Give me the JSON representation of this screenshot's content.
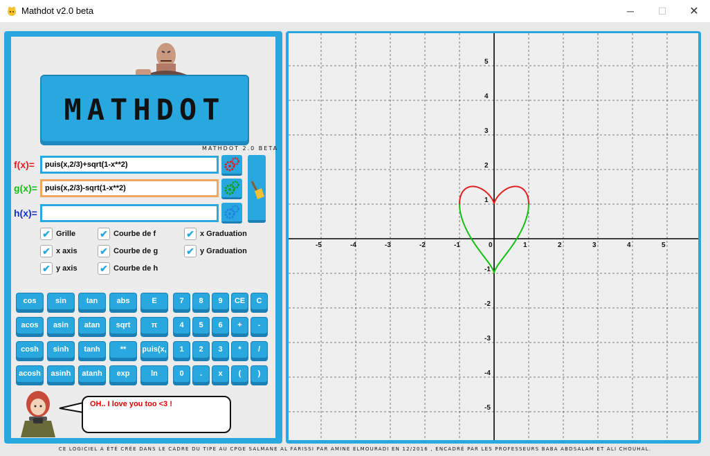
{
  "window": {
    "title": "Mathdot v2.0 beta",
    "minimize_glyph": "─",
    "maximize_glyph": "☐",
    "close_glyph": "✕"
  },
  "logo": {
    "text": "MATHDOT",
    "version": "MATHDOT 2.0 BETA"
  },
  "functions": [
    {
      "label": "f(x)=",
      "value": "puis(x,2/3)+sqrt(1-x**2)",
      "color": "#e02020",
      "icon": "red-gears-icon",
      "gear_color": "#e02020"
    },
    {
      "label": "g(x)=",
      "value": "puis(x,2/3)-sqrt(1-x**2)",
      "color": "#10c010",
      "icon": "green-gears-icon",
      "gear_color": "#10a010"
    },
    {
      "label": "h(x)=",
      "value": "",
      "color": "#1030d0",
      "icon": "blue-gears-icon",
      "gear_color": "#2080e0"
    }
  ],
  "options": [
    {
      "label": "Grille",
      "checked": true
    },
    {
      "label": "Courbe de f",
      "checked": true
    },
    {
      "label": "x Graduation",
      "checked": true
    },
    {
      "label": "x axis",
      "checked": true
    },
    {
      "label": "Courbe de g",
      "checked": true
    },
    {
      "label": "y Graduation",
      "checked": true
    },
    {
      "label": "y axis",
      "checked": true
    },
    {
      "label": "Courbe de h",
      "checked": true
    }
  ],
  "keypad": {
    "functions": [
      [
        "cos",
        "sin",
        "tan",
        "abs",
        "E"
      ],
      [
        "acos",
        "asin",
        "atan",
        "sqrt",
        "π"
      ],
      [
        "cosh",
        "sinh",
        "tanh",
        "**",
        "puis(x,"
      ],
      [
        "acosh",
        "asinh",
        "atanh",
        "exp",
        "ln"
      ]
    ],
    "digits": [
      [
        "7",
        "8",
        "9",
        "CE",
        "C"
      ],
      [
        "4",
        "5",
        "6",
        "+",
        "-"
      ],
      [
        "1",
        "2",
        "3",
        "*",
        "/"
      ],
      [
        "0",
        ".",
        "x",
        "(",
        ")"
      ]
    ]
  },
  "message": "OH.. I love you too <3 !",
  "graph": {
    "x_ticks": [
      "-5",
      "-4",
      "-3",
      "-2",
      "-1",
      "0",
      "1",
      "2",
      "3",
      "4",
      "5"
    ],
    "y_ticks": [
      "5",
      "4",
      "3",
      "2",
      "1",
      "-1",
      "-2",
      "-3",
      "-4",
      "-5"
    ]
  },
  "chart_data": {
    "type": "line",
    "xlim": [
      -5.8,
      5.9
    ],
    "ylim": [
      -5.8,
      5.9
    ],
    "grid": true,
    "series": [
      {
        "name": "f",
        "color": "#e02020",
        "expression": "puis(x,2/3)+sqrt(1-x**2)",
        "domain": [
          -1,
          1
        ]
      },
      {
        "name": "g",
        "color": "#10c010",
        "expression": "puis(x,2/3)-sqrt(1-x**2)",
        "domain": [
          -1,
          1
        ]
      }
    ]
  },
  "footer": "CE LOGICIEL A ÉTÉ CRÉE DANS LE CADRE DU TIPE AU CPGE SALMANE AL FARISSI PAR AMINE ELMOURADI EN 12/2016 , ENCADRÉ PAR LES PROFESSEURS BABA ABDSALAM ET ALI CHOUHAL."
}
